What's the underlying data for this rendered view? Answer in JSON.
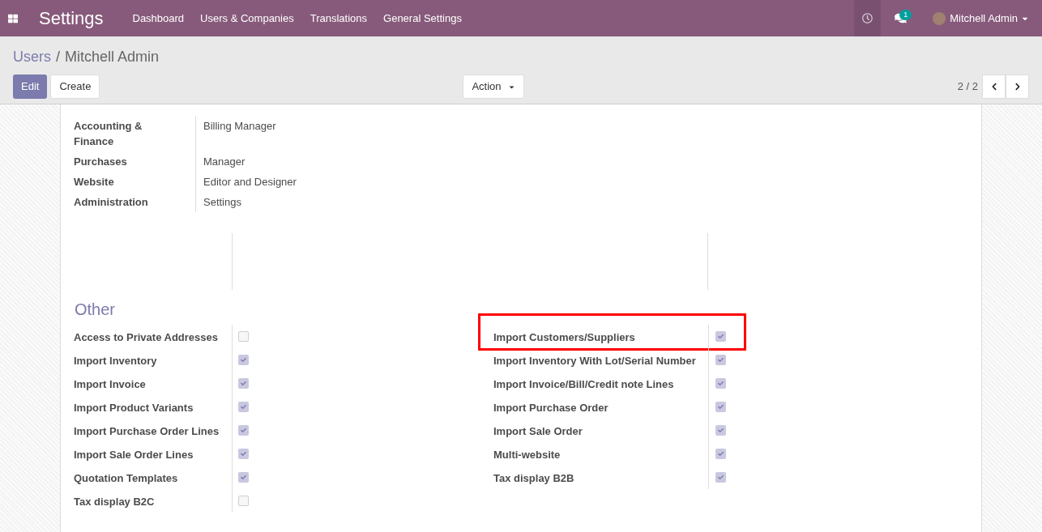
{
  "navbar": {
    "app_title": "Settings",
    "menu": [
      "Dashboard",
      "Users & Companies",
      "Translations",
      "General Settings"
    ],
    "messages_count": "1",
    "user_name": "Mitchell Admin"
  },
  "breadcrumb": {
    "parent": "Users",
    "separator": "/",
    "current": "Mitchell Admin"
  },
  "buttons": {
    "edit": "Edit",
    "create": "Create",
    "action": "Action"
  },
  "pager": "2 / 2",
  "access_rights": [
    {
      "label": "Accounting & Finance",
      "value": "Billing Manager"
    },
    {
      "label": "Purchases",
      "value": "Manager"
    },
    {
      "label": "Website",
      "value": "Editor and Designer"
    },
    {
      "label": "Administration",
      "value": "Settings"
    }
  ],
  "other": {
    "title": "Other",
    "left": [
      {
        "label": "Access to Private Addresses",
        "checked": false
      },
      {
        "label": "Import Inventory",
        "checked": true
      },
      {
        "label": "Import Invoice",
        "checked": true
      },
      {
        "label": "Import Product Variants",
        "checked": true
      },
      {
        "label": "Import Purchase Order Lines",
        "checked": true
      },
      {
        "label": "Import Sale Order Lines",
        "checked": true
      },
      {
        "label": "Quotation Templates",
        "checked": true
      },
      {
        "label": "Tax display B2C",
        "checked": false
      }
    ],
    "right": [
      {
        "label": "Import Customers/Suppliers",
        "checked": true,
        "highlighted": true
      },
      {
        "label": "Import Inventory With Lot/Serial Number",
        "checked": true,
        "highlighted": false
      },
      {
        "label": "Import Invoice/Bill/Credit note Lines",
        "checked": true,
        "highlighted": false
      },
      {
        "label": "Import Purchase Order",
        "checked": true,
        "highlighted": false
      },
      {
        "label": "Import Sale Order",
        "checked": true,
        "highlighted": false
      },
      {
        "label": "Multi-website",
        "checked": true,
        "highlighted": false
      },
      {
        "label": "Tax display B2B",
        "checked": true,
        "highlighted": false
      }
    ]
  }
}
